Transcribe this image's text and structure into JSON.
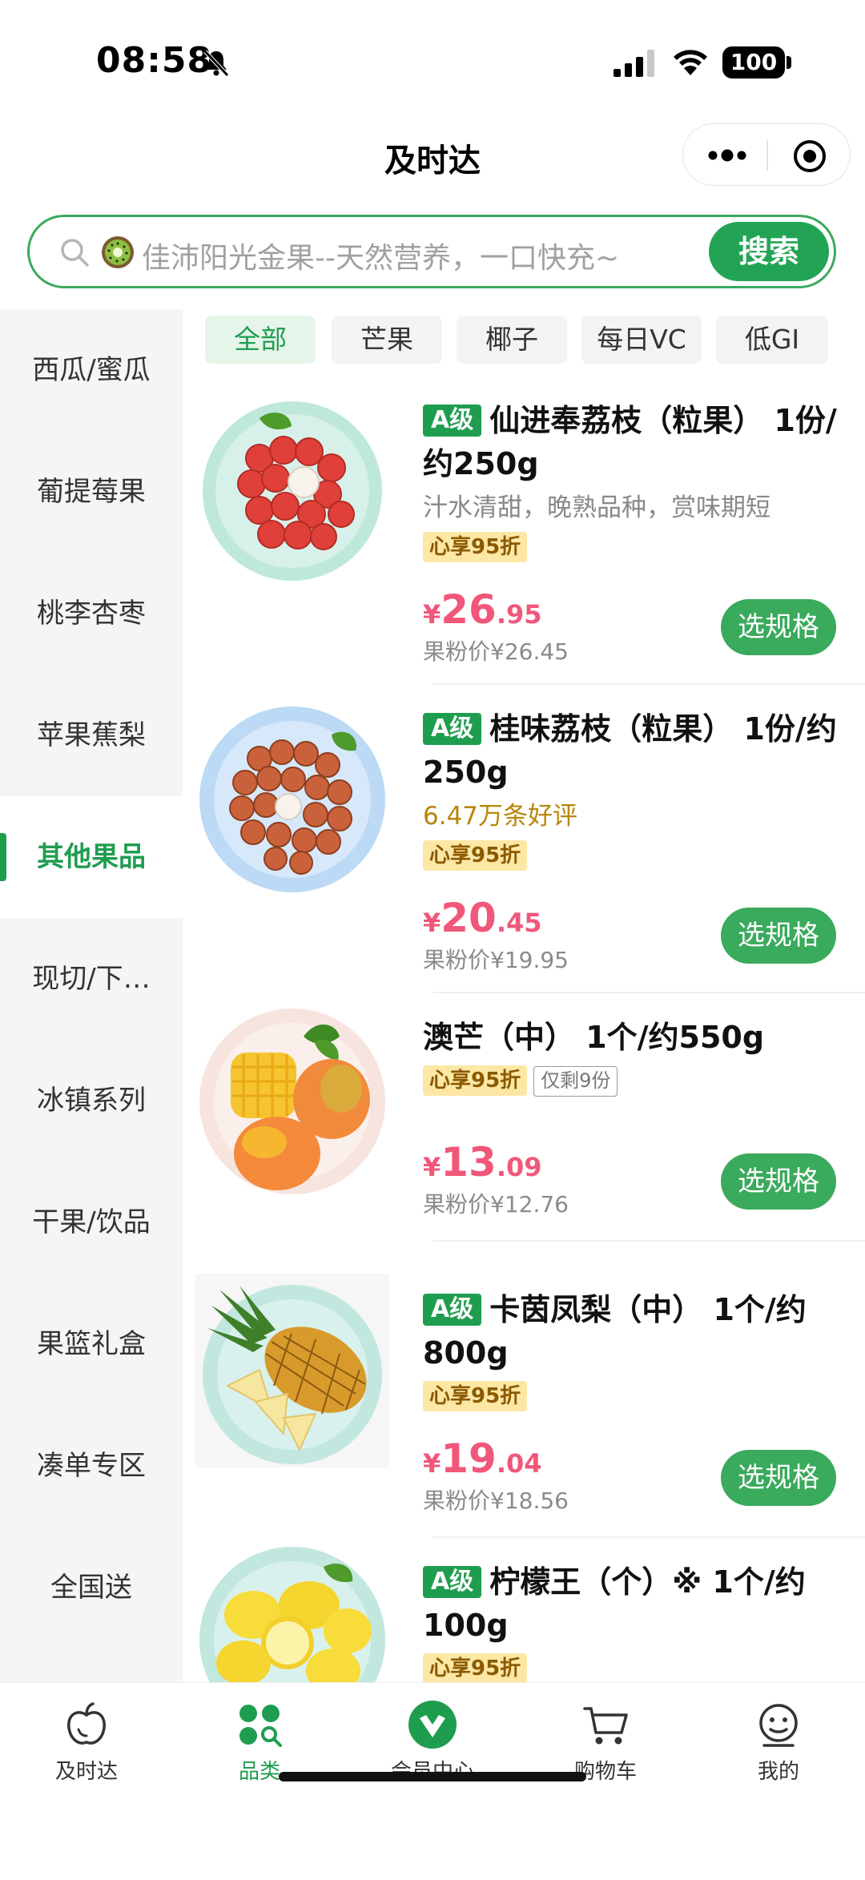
{
  "status_bar": {
    "time": "08:58",
    "battery": "100"
  },
  "header": {
    "title": "及时达"
  },
  "search": {
    "placeholder": "佳沛阳光金果--天然营养，一口快充~",
    "button_label": "搜索"
  },
  "sidebar": {
    "items": [
      {
        "label": "西瓜/蜜瓜",
        "active": false
      },
      {
        "label": "葡提莓果",
        "active": false
      },
      {
        "label": "桃李杏枣",
        "active": false
      },
      {
        "label": "苹果蕉梨",
        "active": false
      },
      {
        "label": "其他果品",
        "active": true
      },
      {
        "label": "现切/下…",
        "active": false
      },
      {
        "label": "冰镇系列",
        "active": false
      },
      {
        "label": "干果/饮品",
        "active": false
      },
      {
        "label": "果篮礼盒",
        "active": false
      },
      {
        "label": "凑单专区",
        "active": false
      },
      {
        "label": "全国送",
        "active": false
      }
    ]
  },
  "chips": [
    {
      "label": "全部",
      "active": true
    },
    {
      "label": "芒果",
      "active": false
    },
    {
      "label": "椰子",
      "active": false
    },
    {
      "label": "每日VC",
      "active": false
    },
    {
      "label": "低GI",
      "active": false
    }
  ],
  "products": [
    {
      "grade": "A级",
      "title": "仙进奉荔枝（粒果） 1份/约250g",
      "subtitle": "汁水清甜，晚熟品种，赏味期短",
      "discount_tag": "心享95折",
      "price_symbol": "¥",
      "price_int": "26",
      "price_dec": ".95",
      "member_price": "果粉价¥26.45",
      "button_label": "选规格",
      "image_icon": "lychee-plate-icon"
    },
    {
      "grade": "A级",
      "title": "桂味荔枝（粒果） 1份/约250g",
      "subtitle": "6.47万条好评",
      "discount_tag": "心享95折",
      "price_symbol": "¥",
      "price_int": "20",
      "price_dec": ".45",
      "member_price": "果粉价¥19.95",
      "button_label": "选规格",
      "image_icon": "lychee-plate-icon"
    },
    {
      "grade": "",
      "title": "澳芒（中） 1个/约550g",
      "discount_tag": "心享95折",
      "stock_tag": "仅剩9份",
      "price_symbol": "¥",
      "price_int": "13",
      "price_dec": ".09",
      "member_price": "果粉价¥12.76",
      "button_label": "选规格",
      "image_icon": "mango-plate-icon"
    },
    {
      "grade": "A级",
      "title": "卡茵凤梨（中） 1个/约800g",
      "discount_tag": "心享95折",
      "price_symbol": "¥",
      "price_int": "19",
      "price_dec": ".04",
      "member_price": "果粉价¥18.56",
      "button_label": "选规格",
      "image_icon": "pineapple-plate-icon"
    },
    {
      "grade": "A级",
      "title": "柠檬王（个）※ 1个/约100g",
      "discount_tag": "心享95折",
      "image_icon": "lemon-plate-icon"
    }
  ],
  "bottom_nav": [
    {
      "label": "及时达",
      "icon": "apple-icon",
      "active": false
    },
    {
      "label": "品类",
      "icon": "category-icon",
      "active": true
    },
    {
      "label": "会员中心",
      "icon": "member-icon",
      "active": false
    },
    {
      "label": "购物车",
      "icon": "cart-icon",
      "active": false
    },
    {
      "label": "我的",
      "icon": "profile-icon",
      "active": false
    }
  ],
  "colors": {
    "brand_green": "#1f9d4f",
    "price_pink": "#f0577a",
    "discount_bg": "#fde7a5"
  }
}
